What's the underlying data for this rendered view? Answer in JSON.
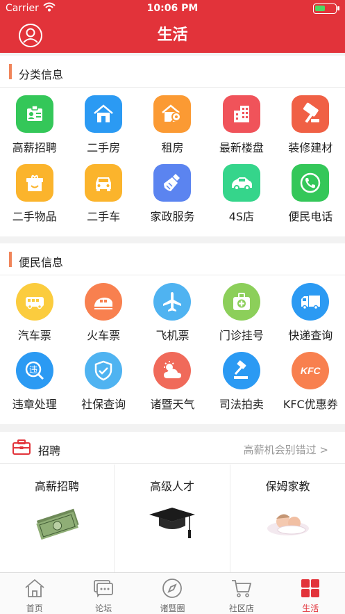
{
  "status_bar": {
    "carrier": "Carrier",
    "time": "10:06 PM"
  },
  "header": {
    "title": "生活"
  },
  "classified": {
    "title": "分类信息",
    "items": [
      {
        "label": "高薪招聘",
        "icon": "id-card-icon",
        "color": "#34c759"
      },
      {
        "label": "二手房",
        "icon": "house-icon",
        "color": "#2b9af3"
      },
      {
        "label": "租房",
        "icon": "house-key-icon",
        "color": "#fb9a33"
      },
      {
        "label": "最新楼盘",
        "icon": "buildings-icon",
        "color": "#f0535a"
      },
      {
        "label": "装修建材",
        "icon": "paint-roller-icon",
        "color": "#f06045"
      },
      {
        "label": "二手物品",
        "icon": "gift-box-icon",
        "color": "#fbb42c"
      },
      {
        "label": "二手车",
        "icon": "car-front-icon",
        "color": "#fbb42c"
      },
      {
        "label": "家政服务",
        "icon": "broom-icon",
        "color": "#5b84f0"
      },
      {
        "label": "4S店",
        "icon": "car-icon",
        "color": "#35d58b"
      },
      {
        "label": "便民电话",
        "icon": "phone-icon",
        "color": "#34c759"
      }
    ]
  },
  "convenience": {
    "title": "便民信息",
    "items": [
      {
        "label": "汽车票",
        "icon": "bus-icon",
        "color": "#fbcc3e"
      },
      {
        "label": "火车票",
        "icon": "train-icon",
        "color": "#f8804f"
      },
      {
        "label": "飞机票",
        "icon": "airplane-icon",
        "color": "#4fb3f1"
      },
      {
        "label": "门诊挂号",
        "icon": "medical-kit-icon",
        "color": "#8ccf5a"
      },
      {
        "label": "快递查询",
        "icon": "truck-icon",
        "color": "#2b9af3"
      },
      {
        "label": "违章处理",
        "icon": "violation-search-icon",
        "color": "#2b9af3"
      },
      {
        "label": "社保查询",
        "icon": "shield-check-icon",
        "color": "#4fb3f1"
      },
      {
        "label": "诸暨天气",
        "icon": "weather-icon",
        "color": "#f06a5a"
      },
      {
        "label": "司法拍卖",
        "icon": "gavel-icon",
        "color": "#2b9af3"
      },
      {
        "label": "KFC优惠券",
        "icon": "kfc-icon",
        "color": "#f8804f",
        "icon_text": "KFC"
      }
    ]
  },
  "recruitment": {
    "title": "招聘",
    "more": "高薪机会别错过 >",
    "columns": [
      {
        "label": "高薪招聘",
        "image": "money-stack-image"
      },
      {
        "label": "高级人才",
        "image": "graduation-cap-image"
      },
      {
        "label": "保姆家教",
        "image": "baby-image"
      }
    ]
  },
  "tabbar": {
    "tabs": [
      {
        "label": "首页",
        "icon": "home-icon",
        "active": false
      },
      {
        "label": "论坛",
        "icon": "chat-icon",
        "active": false
      },
      {
        "label": "诸暨圈",
        "icon": "compass-icon",
        "active": false
      },
      {
        "label": "社区店",
        "icon": "cart-icon",
        "active": false
      },
      {
        "label": "生活",
        "icon": "grid-icon",
        "active": true
      }
    ]
  },
  "colors": {
    "brand": "#e2333a",
    "accent_bar": "#f0855a"
  }
}
